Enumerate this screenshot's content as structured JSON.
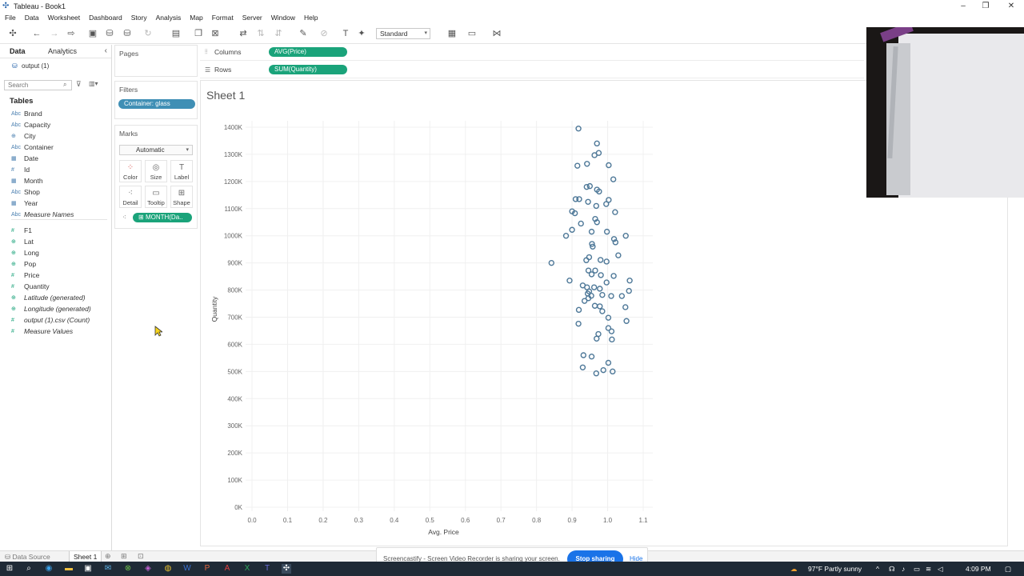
{
  "window": {
    "title": "Tableau - Book1",
    "controls": [
      "–",
      "❐",
      "✕"
    ]
  },
  "menu": [
    "File",
    "Data",
    "Worksheet",
    "Dashboard",
    "Story",
    "Analysis",
    "Map",
    "Format",
    "Server",
    "Window",
    "Help"
  ],
  "toolbar": {
    "fit_select": "Standard"
  },
  "data_pane": {
    "tabs": [
      "Data",
      "Analytics"
    ],
    "datasource": "output (1)",
    "search_placeholder": "Search",
    "tables_header": "Tables",
    "fields": [
      {
        "name": "Brand",
        "type": "Abc",
        "italic": false
      },
      {
        "name": "Capacity",
        "type": "Abc",
        "italic": false
      },
      {
        "name": "City",
        "type": "geo",
        "italic": false
      },
      {
        "name": "Container",
        "type": "Abc",
        "italic": false
      },
      {
        "name": "Date",
        "type": "date",
        "italic": false
      },
      {
        "name": "Id",
        "type": "#",
        "italic": false
      },
      {
        "name": "Month",
        "type": "date",
        "italic": false
      },
      {
        "name": "Shop",
        "type": "Abc",
        "italic": false
      },
      {
        "name": "Year",
        "type": "date",
        "italic": false
      },
      {
        "name": "Measure Names",
        "type": "Abc",
        "italic": true
      },
      {
        "name": "F1",
        "type": "#",
        "italic": false
      },
      {
        "name": "Lat",
        "type": "geo",
        "italic": false
      },
      {
        "name": "Long",
        "type": "geo",
        "italic": false
      },
      {
        "name": "Pop",
        "type": "geo",
        "italic": false
      },
      {
        "name": "Price",
        "type": "#",
        "italic": false
      },
      {
        "name": "Quantity",
        "type": "#",
        "italic": false
      },
      {
        "name": "Latitude (generated)",
        "type": "geo",
        "italic": true
      },
      {
        "name": "Longitude (generated)",
        "type": "geo",
        "italic": true
      },
      {
        "name": "output (1).csv (Count)",
        "type": "#",
        "italic": true
      },
      {
        "name": "Measure Values",
        "type": "#",
        "italic": true
      }
    ]
  },
  "cards": {
    "pages_title": "Pages",
    "filters_title": "Filters",
    "filter_pill": "Container: glass",
    "marks_title": "Marks",
    "mark_type": "Automatic",
    "mark_buttons": [
      "Color",
      "Size",
      "Label",
      "Detail",
      "Tooltip",
      "Shape"
    ],
    "mark_pill": "MONTH(Da.."
  },
  "shelves": {
    "columns_label": "Columns",
    "columns_pill": "AVG(Price)",
    "rows_label": "Rows",
    "rows_pill": "SUM(Quantity)"
  },
  "sheet": {
    "title": "Sheet 1"
  },
  "chart_data": {
    "type": "scatter",
    "xlabel": "Avg. Price",
    "ylabel": "Quantity",
    "xlim": [
      0.0,
      1.1
    ],
    "ylim": [
      0,
      1400000
    ],
    "x_ticks": [
      "0.0",
      "0.1",
      "0.2",
      "0.3",
      "0.4",
      "0.5",
      "0.6",
      "0.7",
      "0.8",
      "0.9",
      "1.0",
      "1.1"
    ],
    "y_ticks": [
      "0K",
      "100K",
      "200K",
      "300K",
      "400K",
      "500K",
      "600K",
      "700K",
      "800K",
      "900K",
      "1000K",
      "1100K",
      "1200K",
      "1300K",
      "1400K"
    ],
    "grid": true,
    "marker": "hollow-circle",
    "marker_color": "#4e7898",
    "points": [
      {
        "x": 0.918,
        "y": 1395000
      },
      {
        "x": 0.97,
        "y": 1340000
      },
      {
        "x": 0.975,
        "y": 1305000
      },
      {
        "x": 0.963,
        "y": 1297000
      },
      {
        "x": 0.942,
        "y": 1265000
      },
      {
        "x": 0.915,
        "y": 1258000
      },
      {
        "x": 1.003,
        "y": 1260000
      },
      {
        "x": 1.016,
        "y": 1208000
      },
      {
        "x": 0.95,
        "y": 1183000
      },
      {
        "x": 0.941,
        "y": 1180000
      },
      {
        "x": 0.97,
        "y": 1170000
      },
      {
        "x": 0.976,
        "y": 1163000
      },
      {
        "x": 0.92,
        "y": 1135000
      },
      {
        "x": 0.91,
        "y": 1135000
      },
      {
        "x": 0.945,
        "y": 1125000
      },
      {
        "x": 1.003,
        "y": 1132000
      },
      {
        "x": 0.968,
        "y": 1110000
      },
      {
        "x": 0.996,
        "y": 1117000
      },
      {
        "x": 0.9,
        "y": 1090000
      },
      {
        "x": 0.908,
        "y": 1083000
      },
      {
        "x": 1.021,
        "y": 1087000
      },
      {
        "x": 0.965,
        "y": 1062000
      },
      {
        "x": 0.97,
        "y": 1050000
      },
      {
        "x": 0.925,
        "y": 1045000
      },
      {
        "x": 0.9,
        "y": 1022000
      },
      {
        "x": 0.955,
        "y": 1015000
      },
      {
        "x": 0.998,
        "y": 1015000
      },
      {
        "x": 0.883,
        "y": 1000000
      },
      {
        "x": 1.051,
        "y": 1000000
      },
      {
        "x": 1.018,
        "y": 988000
      },
      {
        "x": 1.022,
        "y": 976000
      },
      {
        "x": 0.956,
        "y": 970000
      },
      {
        "x": 0.958,
        "y": 960000
      },
      {
        "x": 1.03,
        "y": 928000
      },
      {
        "x": 0.948,
        "y": 921000
      },
      {
        "x": 0.94,
        "y": 910000
      },
      {
        "x": 0.98,
        "y": 911000
      },
      {
        "x": 0.997,
        "y": 905000
      },
      {
        "x": 0.842,
        "y": 900000
      },
      {
        "x": 0.946,
        "y": 872000
      },
      {
        "x": 0.965,
        "y": 872000
      },
      {
        "x": 0.955,
        "y": 858000
      },
      {
        "x": 0.981,
        "y": 855000
      },
      {
        "x": 1.017,
        "y": 852000
      },
      {
        "x": 0.893,
        "y": 835000
      },
      {
        "x": 1.062,
        "y": 835000
      },
      {
        "x": 0.997,
        "y": 828000
      },
      {
        "x": 0.93,
        "y": 817000
      },
      {
        "x": 0.942,
        "y": 810000
      },
      {
        "x": 0.962,
        "y": 810000
      },
      {
        "x": 0.978,
        "y": 805000
      },
      {
        "x": 1.06,
        "y": 797000
      },
      {
        "x": 0.948,
        "y": 795000
      },
      {
        "x": 0.944,
        "y": 787000
      },
      {
        "x": 0.954,
        "y": 779000
      },
      {
        "x": 0.985,
        "y": 782000
      },
      {
        "x": 1.04,
        "y": 778000
      },
      {
        "x": 1.01,
        "y": 778000
      },
      {
        "x": 0.946,
        "y": 770000
      },
      {
        "x": 0.935,
        "y": 760000
      },
      {
        "x": 0.964,
        "y": 742000
      },
      {
        "x": 0.978,
        "y": 740000
      },
      {
        "x": 1.05,
        "y": 737000
      },
      {
        "x": 0.919,
        "y": 727000
      },
      {
        "x": 0.985,
        "y": 722000
      },
      {
        "x": 1.002,
        "y": 698000
      },
      {
        "x": 1.053,
        "y": 686000
      },
      {
        "x": 0.918,
        "y": 676000
      },
      {
        "x": 1.002,
        "y": 660000
      },
      {
        "x": 1.011,
        "y": 648000
      },
      {
        "x": 0.974,
        "y": 638000
      },
      {
        "x": 0.969,
        "y": 621000
      },
      {
        "x": 1.012,
        "y": 618000
      },
      {
        "x": 0.932,
        "y": 560000
      },
      {
        "x": 0.955,
        "y": 555000
      },
      {
        "x": 1.002,
        "y": 532000
      },
      {
        "x": 0.93,
        "y": 515000
      },
      {
        "x": 0.988,
        "y": 505000
      },
      {
        "x": 1.014,
        "y": 500000
      },
      {
        "x": 0.968,
        "y": 493000
      }
    ]
  },
  "bottom_tabs": {
    "datasource_tab": "Data Source",
    "sheet_tab": "Sheet 1"
  },
  "screencastify": {
    "message": "Screencastify - Screen Video Recorder is sharing your screen.",
    "stop_label": "Stop sharing",
    "hide_label": "Hide"
  },
  "taskbar": {
    "weather": "97°F  Partly sunny",
    "time": "4:09 PM"
  }
}
